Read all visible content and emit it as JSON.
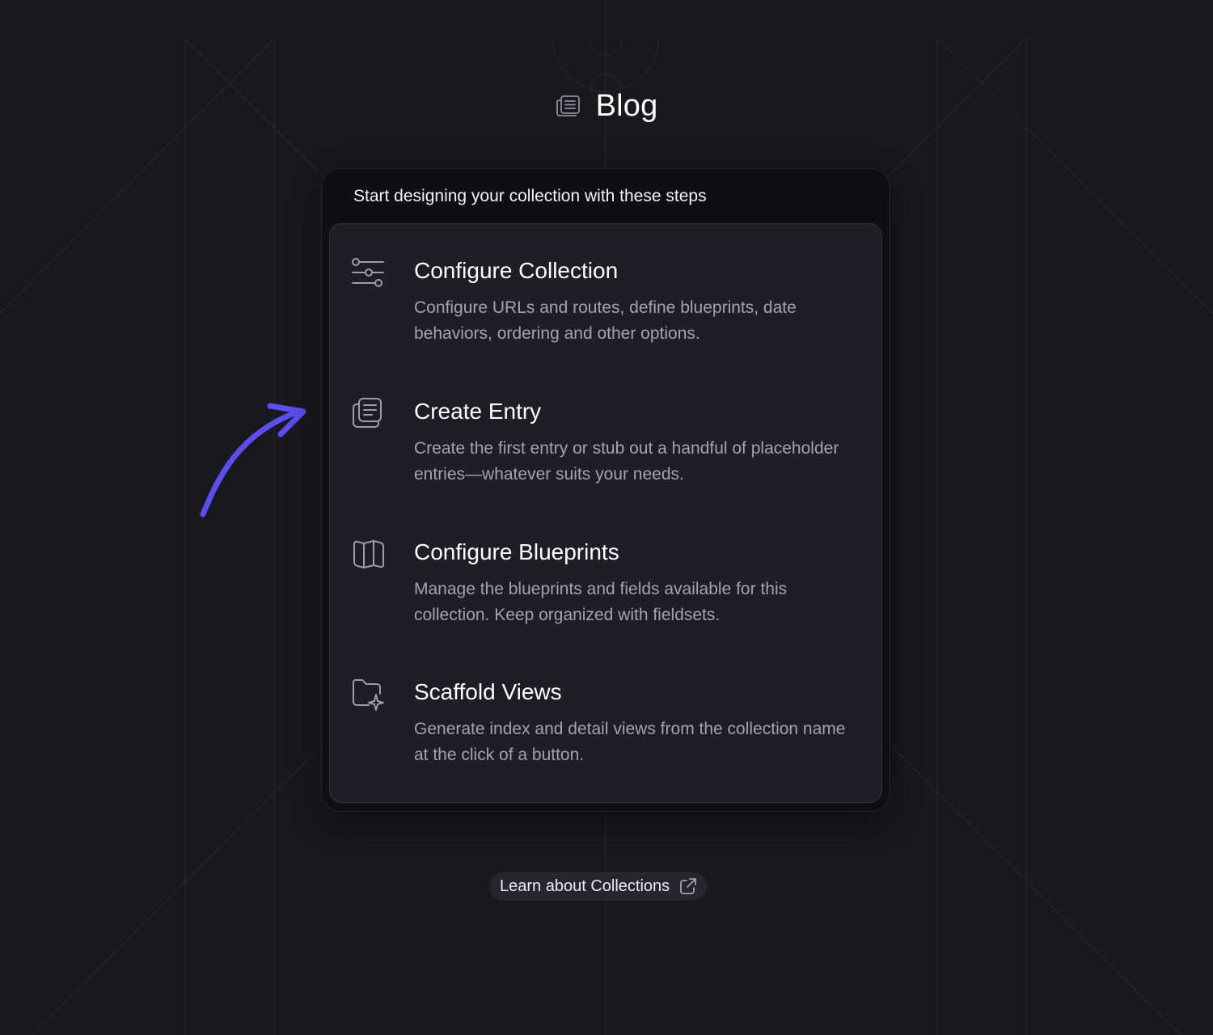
{
  "header": {
    "title": "Blog",
    "icon": "collection-icon"
  },
  "card": {
    "heading": "Start designing your collection with these steps",
    "steps": [
      {
        "title": "Configure Collection",
        "description": "Configure URLs and routes, define blueprints, date behaviors, ordering and other options.",
        "icon": "sliders-icon"
      },
      {
        "title": "Create Entry",
        "description": "Create the first entry or stub out a handful of placeholder entries—whatever suits your needs.",
        "icon": "entries-icon"
      },
      {
        "title": "Configure Blueprints",
        "description": "Manage the blueprints and fields available for this collection. Keep organized with fieldsets.",
        "icon": "blueprint-map-icon"
      },
      {
        "title": "Scaffold Views",
        "description": "Generate index and detail views from the collection name at the click of a button.",
        "icon": "folder-sparkle-icon"
      }
    ]
  },
  "footer": {
    "link_label": "Learn about Collections",
    "link_icon": "external-link-icon"
  },
  "colors": {
    "background": "#19181d",
    "card_outer": "#0f0f12",
    "card_inner": "#1f1e24",
    "arrow_accent": "#5b4ef0",
    "muted_text": "#a4a3ac"
  }
}
